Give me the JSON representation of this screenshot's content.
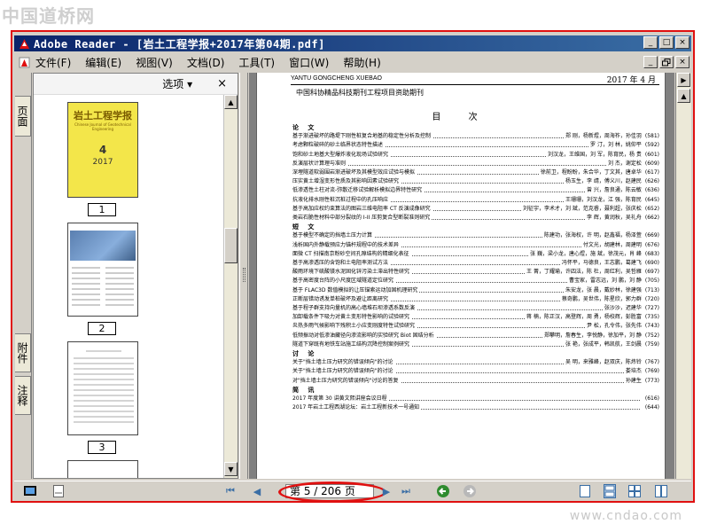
{
  "watermark": {
    "site_cn": "中国道桥网",
    "site_url": "www.cndao.com"
  },
  "window": {
    "title": "Adobe Reader - [岩土工程学报+2017年第04期.pdf]",
    "minimize": "_",
    "maximize": "□",
    "close": "×"
  },
  "menu": {
    "items": [
      "文件(F)",
      "编辑(E)",
      "视图(V)",
      "文档(D)",
      "工具(T)",
      "窗口(W)",
      "帮助(H)"
    ]
  },
  "sidebar": {
    "tabs": [
      "页面",
      "附件",
      "注释"
    ],
    "options_label": "选项 ▾",
    "close_label": "×",
    "thumbnails": [
      {
        "number": "1",
        "cover_title": "岩土工程学报",
        "cover_subtitle": "Chinese Journal of Geotechnical Engineering",
        "cover_issue": "4",
        "cover_year": "2017"
      },
      {
        "number": "2"
      },
      {
        "number": "3"
      }
    ]
  },
  "document": {
    "journal_en": "YANTU GONGCHENG XUEBAO",
    "issue_date": "2017 年 4 月",
    "sponsor": "中国科协精品科技期刊工程项目资助期刊",
    "toc_heading": "目 次",
    "sections": [
      {
        "label": "论 文",
        "entries": [
          {
            "title": "基于渐进破坏的路堤下刚性桩复合地基的稳定性分析及控制",
            "authors": "郑 刚，杨新煜，周海祚，孙佳羽",
            "page": "(581)"
          },
          {
            "title": "考虑颗粒破碎的砂土临界状态特性描述",
            "authors": "罗 汀，刘 林，姚仰平",
            "page": "(592)"
          },
          {
            "title": "饱和砂土地基大型爆炸液化现场试验研究",
            "authors": "刘汉龙，王维国，刘 军，陈育民，杨 贵",
            "page": "(601)"
          },
          {
            "title": "反演层状计算理与准则",
            "authors": "刘 杰，谢定松",
            "page": "(609)"
          },
          {
            "title": "深埋隧道软弱围岩渐进破坏及其模型效应试验与模拟",
            "authors": "徐前卫，程盼盼，朱合华，丁文其，唐卓华",
            "page": "(617)"
          },
          {
            "title": "压实黄土增湿变形性质及其影响因素试验研究",
            "authors": "杨玉生，李 靖，傅义川，赵建民",
            "page": "(626)"
          },
          {
            "title": "低渗透性土柱对流-弥散迁移试验解析模拟边界特性研究",
            "authors": "曾 兴，詹良通，陈云敏",
            "page": "(636)"
          },
          {
            "title": "抗液化排水刚性桩沉桩过程中的孔压响应",
            "authors": "王珊珊，刘汉龙，江 强，陈育民",
            "page": "(645)"
          },
          {
            "title": "基于高加应权约束算法的图岩三维电阻率 CT 反演成像研究",
            "authors": "刘征宇，李术才，刘 斌，范克睿，聂利超，张庆松",
            "page": "(652)"
          },
          {
            "title": "类岩石脆性材料中部分裂纹的 I-II 压剪复合型断裂准则研究",
            "authors": "李 辉，黄润秋，吴礼舟",
            "page": "(662)"
          }
        ]
      },
      {
        "label": "短 文",
        "entries": [
          {
            "title": "基于模型不确定的挡墙土压力计算",
            "authors": "陈建功，张海权，许 明，赵鑫福，杨泽萱",
            "page": "(669)"
          },
          {
            "title": "浅析国内外静载预应力锚杆规程中的技术差异",
            "authors": "付文光，胡建林，周建明",
            "page": "(676)"
          },
          {
            "title": "面微 CT 扫描南京粉砂空间孔隙结构的精细化表征",
            "authors": "张 巍，梁小龙，唐心煜，施 斌，徐茂元，肖 峰",
            "page": "(683)"
          },
          {
            "title": "基于高渗透压的含饱和土电阻率测试方法",
            "authors": "冯怀平，马德良，王志鹏，葛建飞",
            "page": "(690)"
          },
          {
            "title": "酸雨环境下硫酸镁水泥固化锌污染土滞出特性研究",
            "authors": "王 菁，丁耀瑜，许四法，陈 杜，周红利，吴哲雁",
            "page": "(697)"
          },
          {
            "title": "基于高密度台阵的小尺度区域隧道定位研究",
            "authors": "曹宝家，雷志远，刘 鹏，刘 静",
            "page": "(705)"
          },
          {
            "title": "基于 FLAC3D 数值模拟的让压锚索运动加固机理研究",
            "authors": "朱安龙，张 晨，戴妙林，徐建强",
            "page": "(713)"
          },
          {
            "title": "正断层错动诱发单桩破坏及避让距离研究",
            "authors": "蔡奇鹏，吴世伟，陈星欣，郭力群",
            "page": "(720)"
          },
          {
            "title": "基于程子群支持向量机的高心墙堆石坝渗透系数反演",
            "authors": "张沙沙，迟建华",
            "page": "(727)"
          },
          {
            "title": "加卸载条件下吸力对黄土变形特性影响的试验研究",
            "authors": "蒋 楠，陈正汉，高登辉，周 勇，杨校辉，彭胜富",
            "page": "(735)"
          },
          {
            "title": "炎热多雨气候影响下残积土小应变刚度特性试验研究",
            "authors": "尹 松，孔令伟，张先伟",
            "page": "(743)"
          },
          {
            "title": "低频振动对低渗油藏径向渗流影响的实验研究 Biot 固结分析",
            "authors": "郑攀明，詹春生，李悦静，徐加平，刘 静",
            "page": "(752)"
          },
          {
            "title": "隧道下穿既有地铁车站施工结构沉降控制案例研究",
            "authors": "张 艳，张成平，韩凯航，王剑晨",
            "page": "(759)"
          }
        ]
      },
      {
        "label": "讨 论",
        "entries": [
          {
            "title": "关于\"挡土墙土压力研究的错误倾向\"的讨论",
            "authors": "吴 明，来雅峰，赵双庆，陈炜铃",
            "page": "(767)"
          },
          {
            "title": "关于\"挡土墙土压力研究的错误倾向\"的讨论",
            "authors": "娄培杰",
            "page": "(769)"
          },
          {
            "title": "对\"挡土墙土压力研究的错误倾向\"讨论的答复",
            "authors": "孙建生",
            "page": "(773)"
          }
        ]
      },
      {
        "label": "简 讯",
        "entries": [
          {
            "title": "2017 年度第 30 讲黄文熙讲座会议日程",
            "authors": "",
            "page": "(616)"
          },
          {
            "title": "2017 年岩土工程西湖论坛：岩土工程新技术一号通知",
            "authors": "",
            "page": "(644)"
          }
        ]
      }
    ]
  },
  "statusbar": {
    "page_indicator": "第 5 / 206 页",
    "first": "⏮",
    "prev": "◀",
    "next": "▶",
    "last": "⏭"
  },
  "colors": {
    "annotation_red": "#e01010",
    "title_bar": "#0a246a",
    "cover_yellow": "#f3e64a"
  }
}
